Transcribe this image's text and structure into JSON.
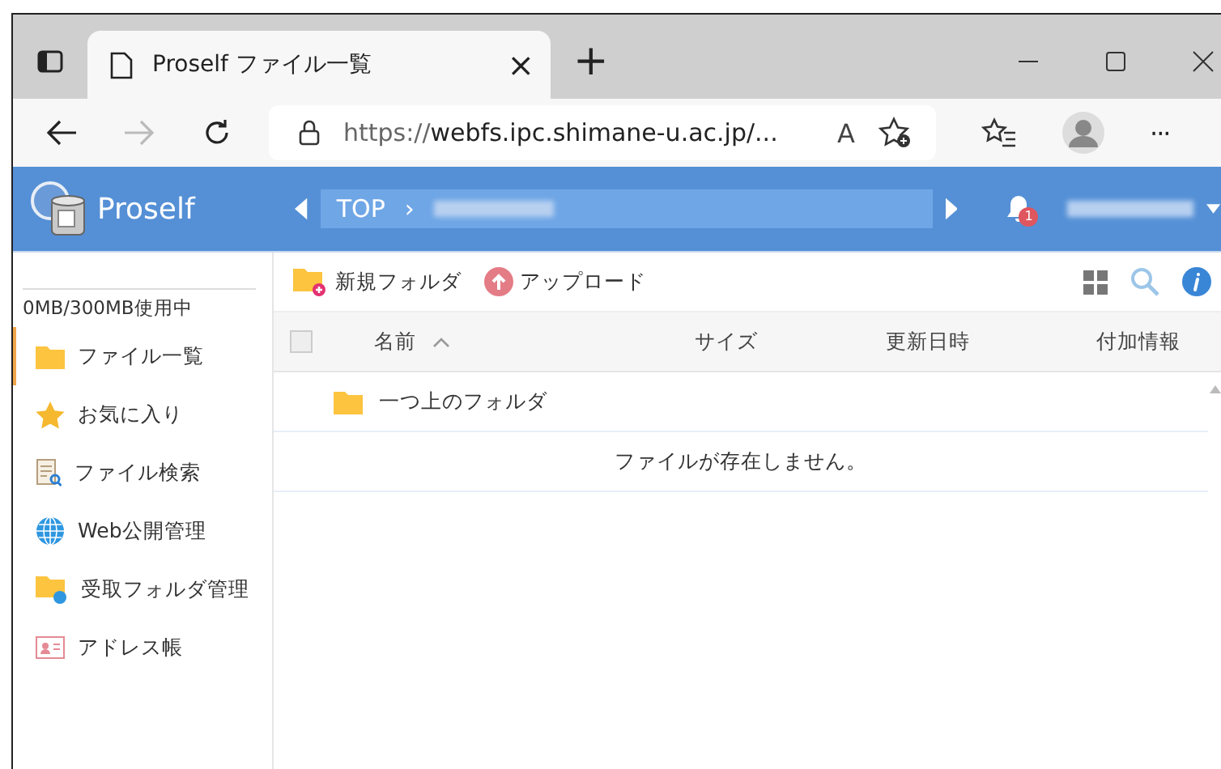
{
  "browser": {
    "tab_title": "Proself ファイル一覧",
    "close_tab": "×",
    "new_tab": "+",
    "url_prefix": "https://",
    "url_host": "webfs.ipc.shimane-u.ac.jp/...",
    "read_aloud": "A",
    "more": "···"
  },
  "header": {
    "app_name": "Proself",
    "breadcrumb_root": "TOP",
    "breadcrumb_sep": "›",
    "notification_count": "1"
  },
  "sidebar": {
    "quota": "0MB/300MB使用中",
    "items": [
      {
        "label": "ファイル一覧",
        "kind": "folder",
        "selected": true
      },
      {
        "label": "お気に入り",
        "kind": "star",
        "selected": false
      },
      {
        "label": "ファイル検索",
        "kind": "search",
        "selected": false
      },
      {
        "label": "Web公開管理",
        "kind": "globe",
        "selected": false
      },
      {
        "label": "受取フォルダ管理",
        "kind": "inbox",
        "selected": false
      },
      {
        "label": "アドレス帳",
        "kind": "contacts",
        "selected": false
      }
    ]
  },
  "toolbar": {
    "new_folder": "新規フォルダ",
    "upload": "アップロード"
  },
  "table": {
    "select_all_checked": false,
    "columns": [
      {
        "label": "名前",
        "sorted": true
      },
      {
        "label": "サイズ",
        "sorted": false
      },
      {
        "label": "更新日時",
        "sorted": false
      },
      {
        "label": "付加情報",
        "sorted": false
      }
    ],
    "parent_row": "一つ上のフォルダ",
    "empty_message": "ファイルが存在しません。"
  }
}
